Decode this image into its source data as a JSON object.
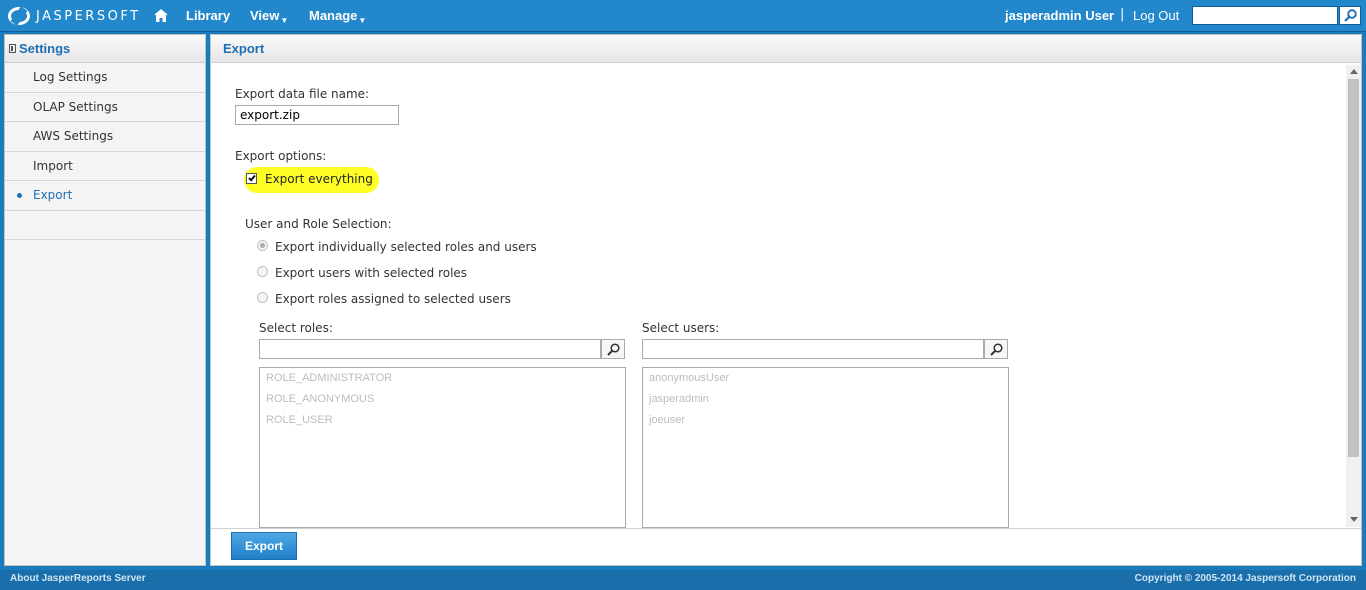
{
  "header": {
    "brand": "JASPERSOFT",
    "home_icon": "home-icon",
    "nav": [
      {
        "label": "Library",
        "has_menu": false
      },
      {
        "label": "View",
        "has_menu": true
      },
      {
        "label": "Manage",
        "has_menu": true
      }
    ],
    "user": "jasperadmin User",
    "separator": "|",
    "logout": "Log Out",
    "search_value": "",
    "search_icon": "search-icon"
  },
  "sidebar": {
    "title": "Settings",
    "items": [
      {
        "label": "Log Settings",
        "active": false
      },
      {
        "label": "OLAP Settings",
        "active": false
      },
      {
        "label": "AWS Settings",
        "active": false
      },
      {
        "label": "Import",
        "active": false
      },
      {
        "label": "Export",
        "active": true
      }
    ]
  },
  "main": {
    "title": "Export",
    "file_name_label": "Export data file name:",
    "file_name_value": "export.zip",
    "options_label": "Export options:",
    "export_everything_label": "Export everything",
    "export_everything_checked": true,
    "selection_label": "User and Role Selection:",
    "radio_options": [
      {
        "label": "Export individually selected roles and users",
        "checked": true
      },
      {
        "label": "Export users with selected roles",
        "checked": false
      },
      {
        "label": "Export roles assigned to selected users",
        "checked": false
      }
    ],
    "roles_label": "Select roles:",
    "roles_search_value": "",
    "roles": [
      "ROLE_ADMINISTRATOR",
      "ROLE_ANONYMOUS",
      "ROLE_USER"
    ],
    "users_label": "Select users:",
    "users_search_value": "",
    "users": [
      "anonymousUser",
      "jasperadmin",
      "joeuser"
    ],
    "export_button": "Export"
  },
  "footer": {
    "about": "About JasperReports Server",
    "copyright": "Copyright © 2005-2014 Jaspersoft Corporation"
  },
  "colors": {
    "topbar": "#2387cc",
    "accent": "#1d6eb4",
    "highlight": "#ffff00",
    "footer": "#1a6ea9"
  }
}
